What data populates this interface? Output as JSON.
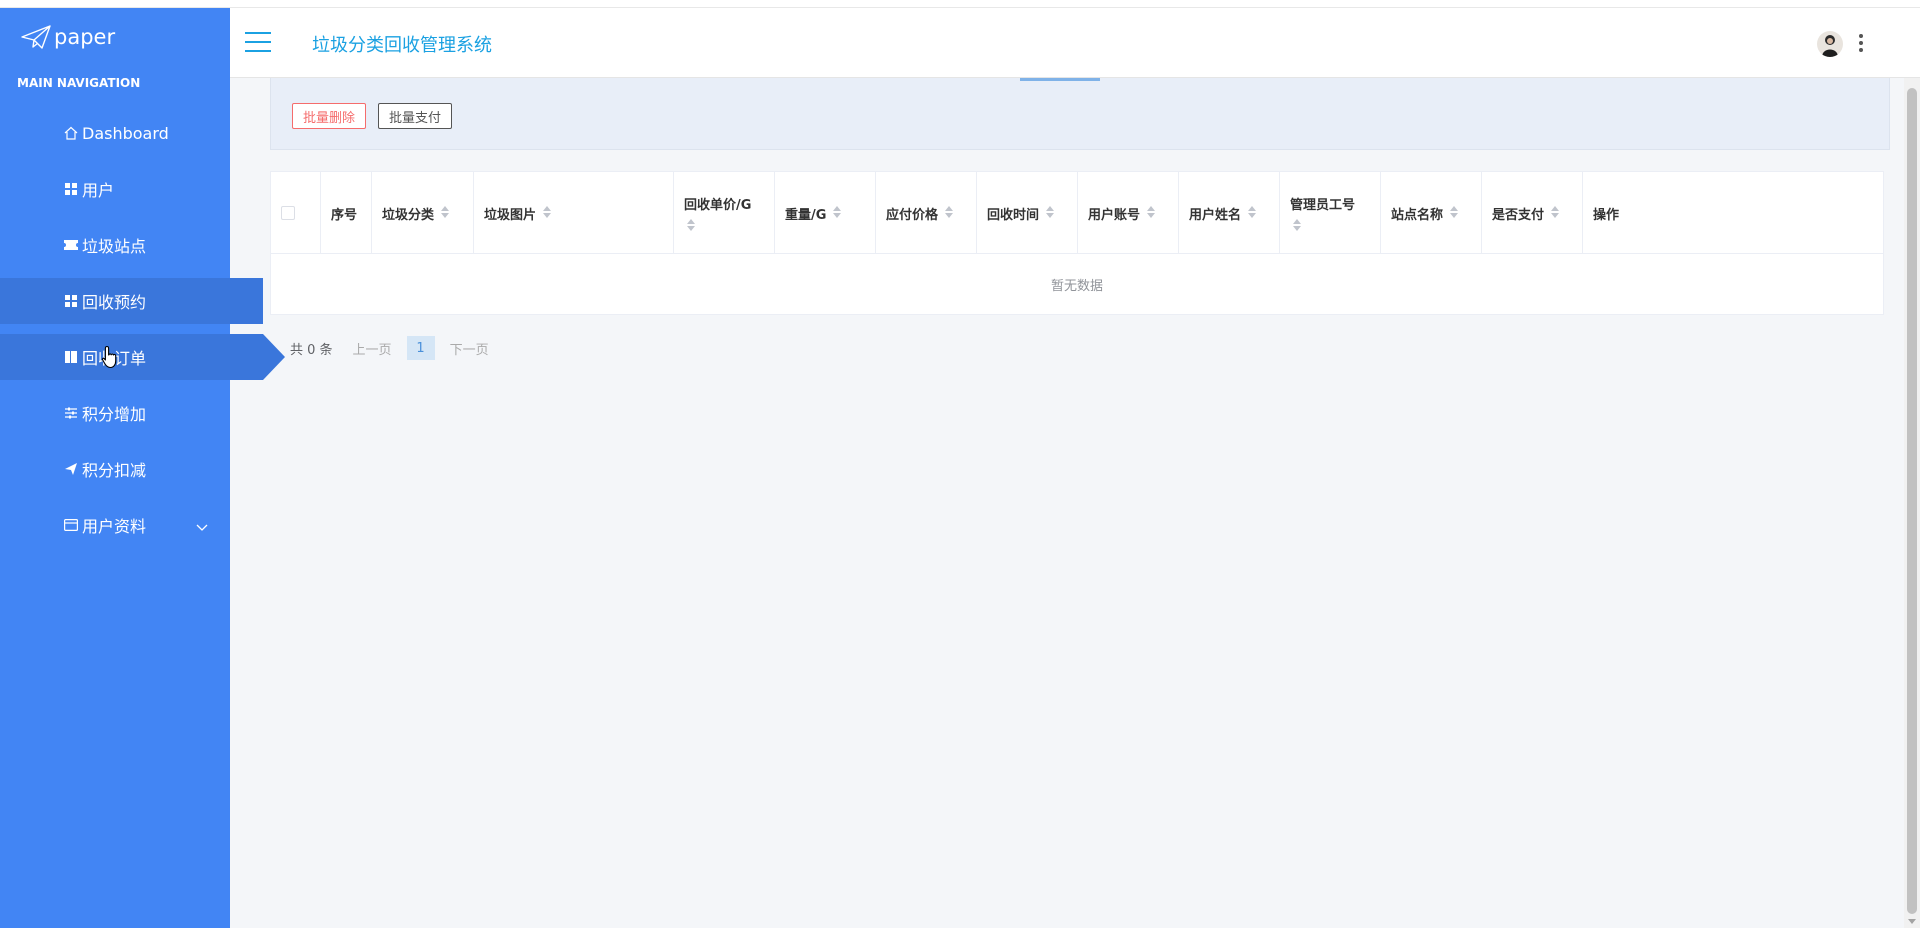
{
  "brand": {
    "name": "paper"
  },
  "sidebar": {
    "section_title": "MAIN NAVIGATION",
    "items": [
      {
        "label": "Dashboard",
        "icon": "home-icon"
      },
      {
        "label": "用户",
        "icon": "grid-icon"
      },
      {
        "label": "垃圾站点",
        "icon": "ticket-icon"
      },
      {
        "label": "回收预约",
        "icon": "grid-icon"
      },
      {
        "label": "回收订单",
        "icon": "book-icon"
      },
      {
        "label": "积分增加",
        "icon": "sliders-icon"
      },
      {
        "label": "积分扣减",
        "icon": "send-icon"
      },
      {
        "label": "用户资料",
        "icon": "card-icon"
      }
    ]
  },
  "header": {
    "title": "垃圾分类回收管理系统"
  },
  "toolbar": {
    "batch_delete": "批量删除",
    "batch_pay": "批量支付"
  },
  "table": {
    "columns": [
      "序号",
      "垃圾分类",
      "垃圾图片",
      "回收单价/G",
      "重量/G",
      "应付价格",
      "回收时间",
      "用户账号",
      "用户姓名",
      "管理员工号",
      "站点名称",
      "是否支付",
      "操作"
    ],
    "empty_text": "暂无数据"
  },
  "pagination": {
    "total": "共 0 条",
    "prev": "上一页",
    "page": "1",
    "next": "下一页"
  },
  "colors": {
    "sidebar": "#4285f4",
    "sidebar_active": "#3a76db",
    "accent": "#1ba1e2",
    "danger": "#f56c6c"
  }
}
